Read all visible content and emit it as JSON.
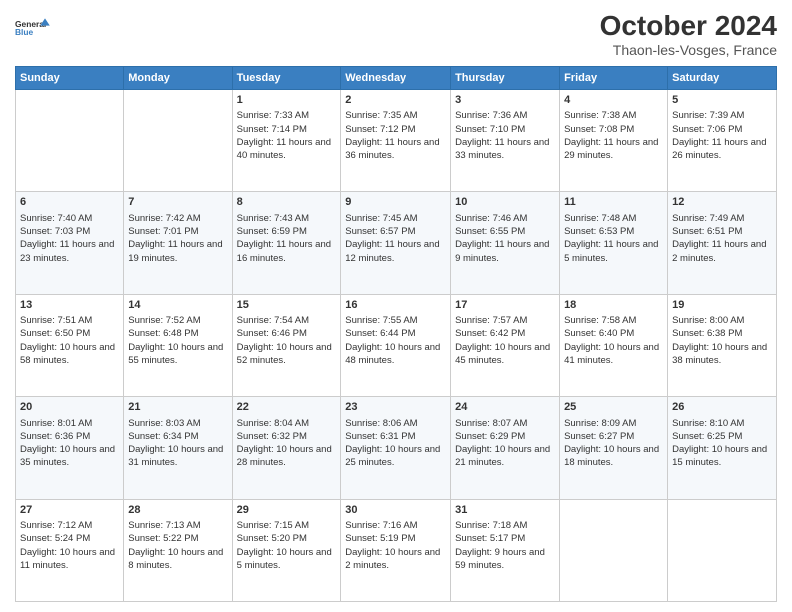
{
  "logo": {
    "line1": "General",
    "line2": "Blue"
  },
  "title": "October 2024",
  "location": "Thaon-les-Vosges, France",
  "days_of_week": [
    "Sunday",
    "Monday",
    "Tuesday",
    "Wednesday",
    "Thursday",
    "Friday",
    "Saturday"
  ],
  "weeks": [
    [
      {
        "day": "",
        "sunrise": "",
        "sunset": "",
        "daylight": ""
      },
      {
        "day": "",
        "sunrise": "",
        "sunset": "",
        "daylight": ""
      },
      {
        "day": "1",
        "sunrise": "Sunrise: 7:33 AM",
        "sunset": "Sunset: 7:14 PM",
        "daylight": "Daylight: 11 hours and 40 minutes."
      },
      {
        "day": "2",
        "sunrise": "Sunrise: 7:35 AM",
        "sunset": "Sunset: 7:12 PM",
        "daylight": "Daylight: 11 hours and 36 minutes."
      },
      {
        "day": "3",
        "sunrise": "Sunrise: 7:36 AM",
        "sunset": "Sunset: 7:10 PM",
        "daylight": "Daylight: 11 hours and 33 minutes."
      },
      {
        "day": "4",
        "sunrise": "Sunrise: 7:38 AM",
        "sunset": "Sunset: 7:08 PM",
        "daylight": "Daylight: 11 hours and 29 minutes."
      },
      {
        "day": "5",
        "sunrise": "Sunrise: 7:39 AM",
        "sunset": "Sunset: 7:06 PM",
        "daylight": "Daylight: 11 hours and 26 minutes."
      }
    ],
    [
      {
        "day": "6",
        "sunrise": "Sunrise: 7:40 AM",
        "sunset": "Sunset: 7:03 PM",
        "daylight": "Daylight: 11 hours and 23 minutes."
      },
      {
        "day": "7",
        "sunrise": "Sunrise: 7:42 AM",
        "sunset": "Sunset: 7:01 PM",
        "daylight": "Daylight: 11 hours and 19 minutes."
      },
      {
        "day": "8",
        "sunrise": "Sunrise: 7:43 AM",
        "sunset": "Sunset: 6:59 PM",
        "daylight": "Daylight: 11 hours and 16 minutes."
      },
      {
        "day": "9",
        "sunrise": "Sunrise: 7:45 AM",
        "sunset": "Sunset: 6:57 PM",
        "daylight": "Daylight: 11 hours and 12 minutes."
      },
      {
        "day": "10",
        "sunrise": "Sunrise: 7:46 AM",
        "sunset": "Sunset: 6:55 PM",
        "daylight": "Daylight: 11 hours and 9 minutes."
      },
      {
        "day": "11",
        "sunrise": "Sunrise: 7:48 AM",
        "sunset": "Sunset: 6:53 PM",
        "daylight": "Daylight: 11 hours and 5 minutes."
      },
      {
        "day": "12",
        "sunrise": "Sunrise: 7:49 AM",
        "sunset": "Sunset: 6:51 PM",
        "daylight": "Daylight: 11 hours and 2 minutes."
      }
    ],
    [
      {
        "day": "13",
        "sunrise": "Sunrise: 7:51 AM",
        "sunset": "Sunset: 6:50 PM",
        "daylight": "Daylight: 10 hours and 58 minutes."
      },
      {
        "day": "14",
        "sunrise": "Sunrise: 7:52 AM",
        "sunset": "Sunset: 6:48 PM",
        "daylight": "Daylight: 10 hours and 55 minutes."
      },
      {
        "day": "15",
        "sunrise": "Sunrise: 7:54 AM",
        "sunset": "Sunset: 6:46 PM",
        "daylight": "Daylight: 10 hours and 52 minutes."
      },
      {
        "day": "16",
        "sunrise": "Sunrise: 7:55 AM",
        "sunset": "Sunset: 6:44 PM",
        "daylight": "Daylight: 10 hours and 48 minutes."
      },
      {
        "day": "17",
        "sunrise": "Sunrise: 7:57 AM",
        "sunset": "Sunset: 6:42 PM",
        "daylight": "Daylight: 10 hours and 45 minutes."
      },
      {
        "day": "18",
        "sunrise": "Sunrise: 7:58 AM",
        "sunset": "Sunset: 6:40 PM",
        "daylight": "Daylight: 10 hours and 41 minutes."
      },
      {
        "day": "19",
        "sunrise": "Sunrise: 8:00 AM",
        "sunset": "Sunset: 6:38 PM",
        "daylight": "Daylight: 10 hours and 38 minutes."
      }
    ],
    [
      {
        "day": "20",
        "sunrise": "Sunrise: 8:01 AM",
        "sunset": "Sunset: 6:36 PM",
        "daylight": "Daylight: 10 hours and 35 minutes."
      },
      {
        "day": "21",
        "sunrise": "Sunrise: 8:03 AM",
        "sunset": "Sunset: 6:34 PM",
        "daylight": "Daylight: 10 hours and 31 minutes."
      },
      {
        "day": "22",
        "sunrise": "Sunrise: 8:04 AM",
        "sunset": "Sunset: 6:32 PM",
        "daylight": "Daylight: 10 hours and 28 minutes."
      },
      {
        "day": "23",
        "sunrise": "Sunrise: 8:06 AM",
        "sunset": "Sunset: 6:31 PM",
        "daylight": "Daylight: 10 hours and 25 minutes."
      },
      {
        "day": "24",
        "sunrise": "Sunrise: 8:07 AM",
        "sunset": "Sunset: 6:29 PM",
        "daylight": "Daylight: 10 hours and 21 minutes."
      },
      {
        "day": "25",
        "sunrise": "Sunrise: 8:09 AM",
        "sunset": "Sunset: 6:27 PM",
        "daylight": "Daylight: 10 hours and 18 minutes."
      },
      {
        "day": "26",
        "sunrise": "Sunrise: 8:10 AM",
        "sunset": "Sunset: 6:25 PM",
        "daylight": "Daylight: 10 hours and 15 minutes."
      }
    ],
    [
      {
        "day": "27",
        "sunrise": "Sunrise: 7:12 AM",
        "sunset": "Sunset: 5:24 PM",
        "daylight": "Daylight: 10 hours and 11 minutes."
      },
      {
        "day": "28",
        "sunrise": "Sunrise: 7:13 AM",
        "sunset": "Sunset: 5:22 PM",
        "daylight": "Daylight: 10 hours and 8 minutes."
      },
      {
        "day": "29",
        "sunrise": "Sunrise: 7:15 AM",
        "sunset": "Sunset: 5:20 PM",
        "daylight": "Daylight: 10 hours and 5 minutes."
      },
      {
        "day": "30",
        "sunrise": "Sunrise: 7:16 AM",
        "sunset": "Sunset: 5:19 PM",
        "daylight": "Daylight: 10 hours and 2 minutes."
      },
      {
        "day": "31",
        "sunrise": "Sunrise: 7:18 AM",
        "sunset": "Sunset: 5:17 PM",
        "daylight": "Daylight: 9 hours and 59 minutes."
      },
      {
        "day": "",
        "sunrise": "",
        "sunset": "",
        "daylight": ""
      },
      {
        "day": "",
        "sunrise": "",
        "sunset": "",
        "daylight": ""
      }
    ]
  ]
}
